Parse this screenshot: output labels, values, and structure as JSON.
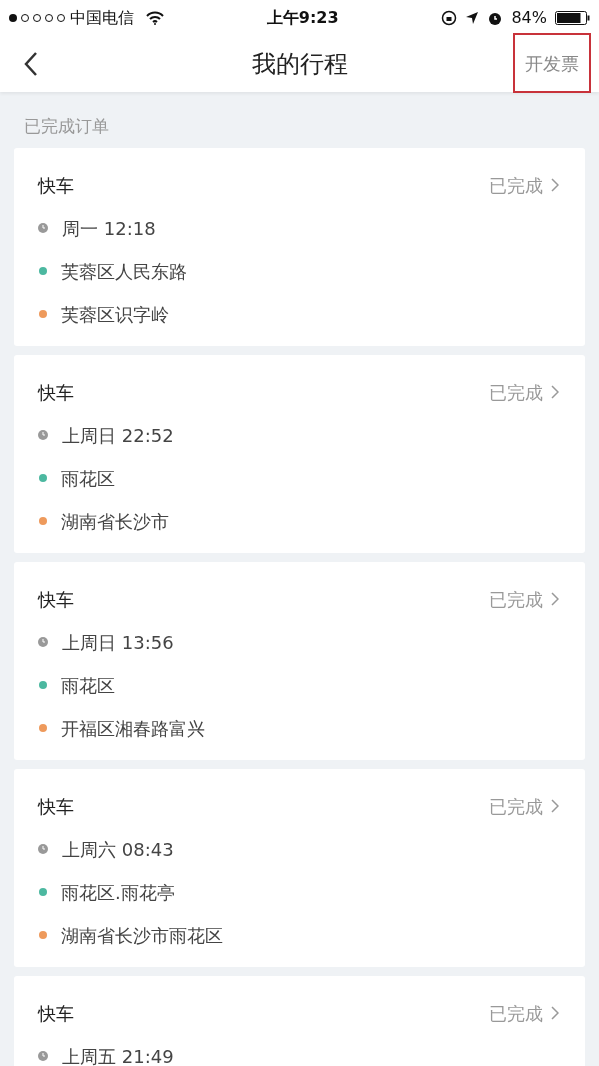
{
  "status_bar": {
    "carrier": "中国电信",
    "time": "上午9:23",
    "battery": "84%"
  },
  "nav": {
    "title": "我的行程",
    "action": {
      "label": "开发票",
      "highlighted": true
    }
  },
  "section_label": "已完成订单",
  "trips": [
    {
      "type": "快车",
      "status": "已完成",
      "time": "周一 12:18",
      "stops": [
        {
          "text": "芙蓉区人民东路",
          "color": "#4cb8a0"
        },
        {
          "text": "芙蓉区识字岭",
          "color": "#ee9a5c"
        }
      ]
    },
    {
      "type": "快车",
      "status": "已完成",
      "time": "上周日 22:52",
      "stops": [
        {
          "text": "雨花区",
          "color": "#4cb8a0"
        },
        {
          "text": "湖南省长沙市",
          "color": "#ee9a5c"
        }
      ]
    },
    {
      "type": "快车",
      "status": "已完成",
      "time": "上周日 13:56",
      "stops": [
        {
          "text": "雨花区",
          "color": "#4cb8a0"
        },
        {
          "text": "开福区湘春路富兴",
          "color": "#ee9a5c"
        }
      ]
    },
    {
      "type": "快车",
      "status": "已完成",
      "time": "上周六 08:43",
      "stops": [
        {
          "text": "雨花区.雨花亭",
          "color": "#4cb8a0"
        },
        {
          "text": "湖南省长沙市雨花区",
          "color": "#ee9a5c"
        }
      ]
    },
    {
      "type": "快车",
      "status": "已完成",
      "time": "上周五 21:49"
    }
  ]
}
